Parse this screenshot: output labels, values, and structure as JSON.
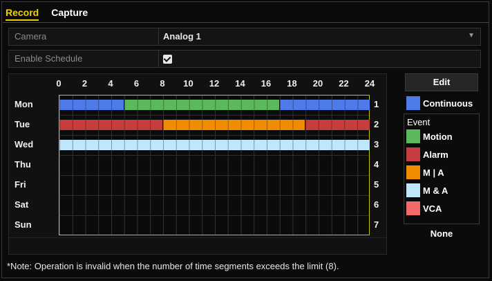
{
  "tabs": [
    {
      "label": "Record",
      "active": true
    },
    {
      "label": "Capture",
      "active": false
    }
  ],
  "camera": {
    "label": "Camera",
    "value": "Analog 1"
  },
  "enable_schedule": {
    "label": "Enable Schedule",
    "checked": true
  },
  "schedule": {
    "hours": [
      "0",
      "2",
      "4",
      "6",
      "8",
      "10",
      "12",
      "14",
      "16",
      "18",
      "20",
      "22",
      "24"
    ],
    "days": [
      {
        "name": "Mon",
        "num": "1",
        "segments": [
          {
            "start": 0,
            "end": 5,
            "type": "Continuous"
          },
          {
            "start": 5,
            "end": 17,
            "type": "Motion"
          },
          {
            "start": 17,
            "end": 24,
            "type": "Continuous"
          }
        ]
      },
      {
        "name": "Tue",
        "num": "2",
        "segments": [
          {
            "start": 0,
            "end": 8,
            "type": "Alarm"
          },
          {
            "start": 8,
            "end": 19,
            "type": "M | A"
          },
          {
            "start": 19,
            "end": 24,
            "type": "Alarm"
          }
        ]
      },
      {
        "name": "Wed",
        "num": "3",
        "segments": [
          {
            "start": 0,
            "end": 24,
            "type": "M & A"
          }
        ]
      },
      {
        "name": "Thu",
        "num": "4",
        "segments": []
      },
      {
        "name": "Fri",
        "num": "5",
        "segments": []
      },
      {
        "name": "Sat",
        "num": "6",
        "segments": []
      },
      {
        "name": "Sun",
        "num": "7",
        "segments": []
      }
    ]
  },
  "edit_button": "Edit",
  "legend": {
    "continuous": {
      "label": "Continuous",
      "color": "#4f7be8"
    },
    "event_title": "Event",
    "events": [
      {
        "label": "Motion",
        "color": "#5cb85c"
      },
      {
        "label": "Alarm",
        "color": "#c63d3f"
      },
      {
        "label": "M | A",
        "color": "#f08c00"
      },
      {
        "label": "M & A",
        "color": "#bfe6fb"
      },
      {
        "label": "VCA",
        "color": "#f06a6a"
      }
    ],
    "none_label": "None"
  },
  "note": "*Note: Operation is invalid when the number of time segments exceeds the limit (8).",
  "icons": {
    "dropdown": "chevron-down-icon",
    "checkbox": "checkmark-icon"
  }
}
